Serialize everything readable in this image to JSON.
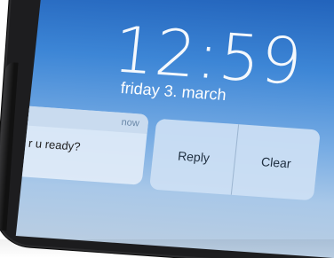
{
  "lock_screen": {
    "time": "12:59",
    "date": "friday 3. march"
  },
  "notification": {
    "time_label": "now",
    "message": "om: r u ready?"
  },
  "actions": {
    "reply_label": "Reply",
    "clear_label": "Clear"
  },
  "colors": {
    "wallpaper_top": "#1f5fb8",
    "wallpaper_bottom": "#b9cde2",
    "phone_frame": "#1d1d1f"
  }
}
